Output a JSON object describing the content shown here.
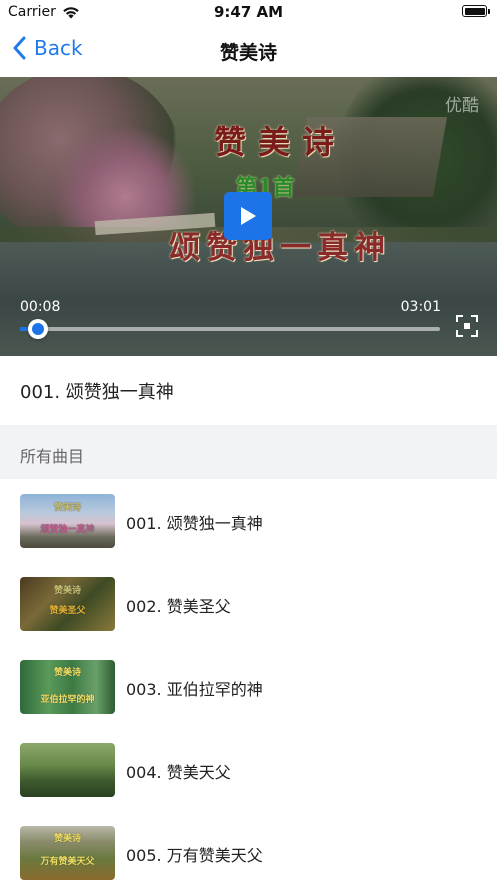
{
  "status_bar": {
    "carrier": "Carrier",
    "time": "9:47 AM"
  },
  "nav": {
    "back_label": "Back",
    "title": "赞美诗"
  },
  "player": {
    "watermark": "优酷",
    "overlay_title": "赞美诗",
    "overlay_subtitle": "第1首",
    "overlay_song": "颂赞独一真神",
    "current_time": "00:08",
    "duration": "03:01",
    "progress": 0.044,
    "accent_color": "#1c74e8"
  },
  "current_track": "001. 颂赞独一真神",
  "section_header": "所有曲目",
  "tracks": [
    {
      "label": "001. 颂赞独一真神",
      "thumb_text_1": "赞美诗",
      "thumb_text_2": "颂赞独一真神"
    },
    {
      "label": "002. 赞美圣父",
      "thumb_text_1": "赞美诗",
      "thumb_text_2": "赞美圣父"
    },
    {
      "label": "003. 亚伯拉罕的神",
      "thumb_text_1": "赞美诗",
      "thumb_text_2": "亚伯拉罕的神"
    },
    {
      "label": "004. 赞美天父",
      "thumb_text_1": "",
      "thumb_text_2": ""
    },
    {
      "label": "005. 万有赞美天父",
      "thumb_text_1": "赞美诗",
      "thumb_text_2": "万有赞美天父"
    }
  ],
  "icons": {
    "wifi": "wifi-icon",
    "battery": "battery-icon",
    "back": "chevron-left-icon",
    "play": "play-icon",
    "fullscreen": "fullscreen-icon"
  }
}
